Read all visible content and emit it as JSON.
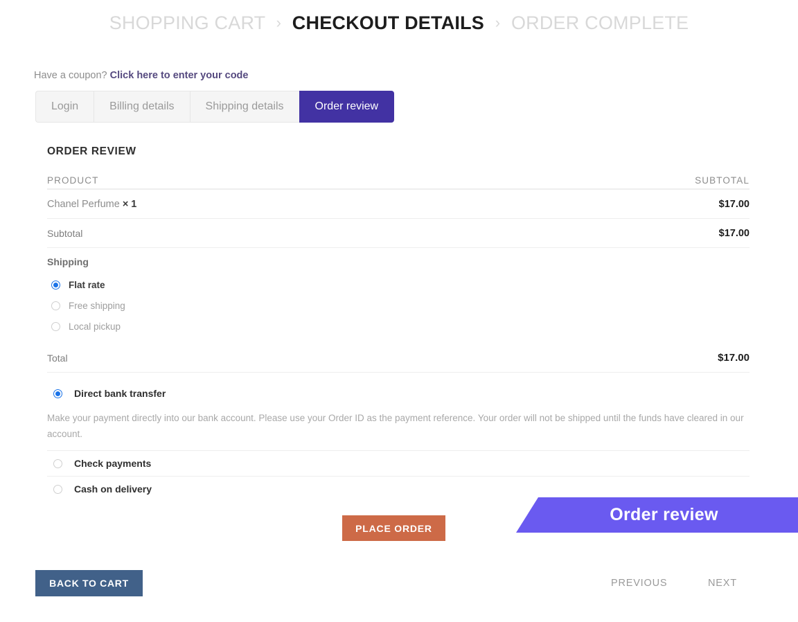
{
  "breadcrumb": {
    "separator": "›",
    "steps": [
      {
        "label": "SHOPPING CART",
        "active": false
      },
      {
        "label": "CHECKOUT DETAILS",
        "active": true
      },
      {
        "label": "ORDER COMPLETE",
        "active": false
      }
    ]
  },
  "coupon": {
    "prompt": "Have a coupon?",
    "link": "Click here to enter your code"
  },
  "tabs": [
    {
      "label": "Login",
      "active": false
    },
    {
      "label": "Billing details",
      "active": false
    },
    {
      "label": "Shipping details",
      "active": false
    },
    {
      "label": "Order review",
      "active": true
    }
  ],
  "order_review": {
    "title": "ORDER REVIEW",
    "columns": {
      "product": "PRODUCT",
      "subtotal": "SUBTOTAL"
    },
    "items": [
      {
        "name": "Chanel Perfume",
        "quantity": "× 1",
        "price": "$17.00"
      }
    ],
    "subtotal": {
      "label": "Subtotal",
      "value": "$17.00"
    },
    "shipping": {
      "label": "Shipping",
      "options": [
        {
          "label": "Flat rate",
          "selected": true
        },
        {
          "label": "Free shipping",
          "selected": false
        },
        {
          "label": "Local pickup",
          "selected": false
        }
      ]
    },
    "total": {
      "label": "Total",
      "value": "$17.00"
    }
  },
  "payment": {
    "methods": [
      {
        "label": "Direct bank transfer",
        "selected": true
      },
      {
        "label": "Check payments",
        "selected": false
      },
      {
        "label": "Cash on delivery",
        "selected": false
      }
    ],
    "description": "Make your payment directly into our bank account. Please use your Order ID as the payment reference. Your order will not be shipped until the funds have cleared in our account."
  },
  "actions": {
    "place_order": "PLACE ORDER",
    "back_to_cart": "BACK TO CART",
    "previous": "PREVIOUS",
    "next": "NEXT"
  },
  "callout": {
    "text": "Order review"
  },
  "colors": {
    "tab_active": "#4232a3",
    "callout": "#6a5af0",
    "place_order": "#cd6a47",
    "back_to_cart": "#416189",
    "radio_selected": "#1a73e8",
    "coupon_link": "#55497f"
  }
}
